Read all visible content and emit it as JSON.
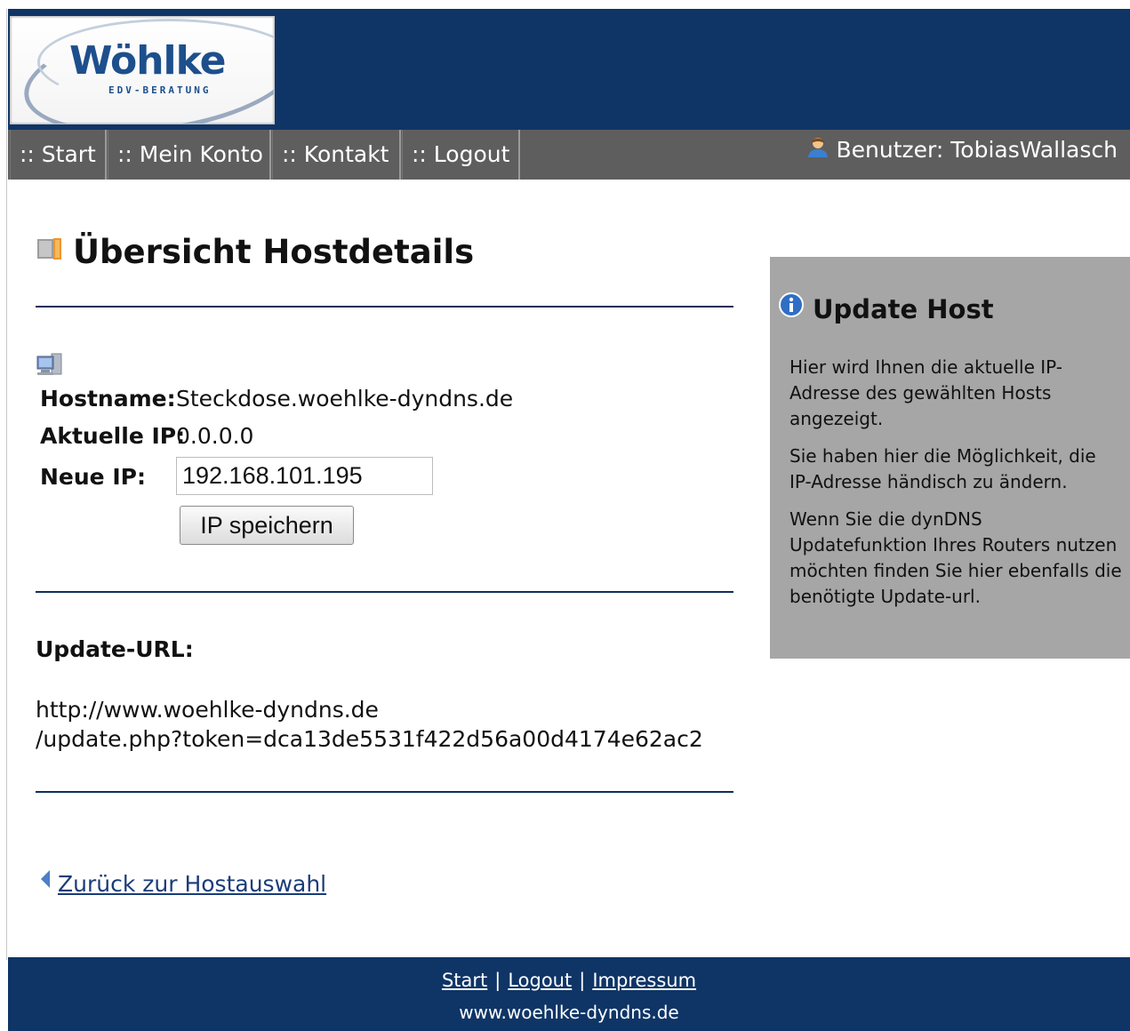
{
  "logo": {
    "name": "Wöhlke",
    "subtitle": "EDV-BERATUNG"
  },
  "nav": {
    "items": [
      {
        "label": ":: Start"
      },
      {
        "label": ":: Mein Konto"
      },
      {
        "label": ":: Kontakt"
      },
      {
        "label": ":: Logout"
      }
    ],
    "user_label": "Benutzer: TobiasWallasch",
    "user_icon": "user-icon"
  },
  "main": {
    "title": "Übersicht Hostdetails",
    "title_icon": "book-icon",
    "host_icon": "computer-icon",
    "hostname_label": "Hostname:",
    "hostname_value": "Steckdose.woehlke-dyndns.de",
    "current_ip_label": "Aktuelle IP:",
    "current_ip_value": "0.0.0.0",
    "new_ip_label": "Neue IP:",
    "new_ip_value": "192.168.101.195",
    "save_label": "IP speichern",
    "update_url_label": "Update-URL:",
    "update_url_line1": "http://www.woehlke-dyndns.de",
    "update_url_line2": "/update.php?token=dca13de5531f422d56a00d4174e62ac2",
    "back_label": "Zurück zur Hostauswahl"
  },
  "sidebar": {
    "title": "Update Host",
    "title_icon": "info-icon",
    "p1": "Hier wird Ihnen die aktuelle IP-Adresse des gewählten Hosts angezeigt.",
    "p2": "Sie haben hier die Möglichkeit, die IP-Adresse händisch zu ändern.",
    "p3": "Wenn Sie die dynDNS Updatefunktion Ihres Routers nutzen möchten finden Sie hier ebenfalls die benötigte Update-url."
  },
  "footer": {
    "links": [
      "Start",
      "Logout",
      "Impressum"
    ],
    "separator": "|",
    "site": "www.woehlke-dyndns.de"
  },
  "colors": {
    "header": "#0f3566",
    "nav": "#5e5e5e",
    "sidebar": "#a6a6a6",
    "link": "#1a3c78"
  }
}
